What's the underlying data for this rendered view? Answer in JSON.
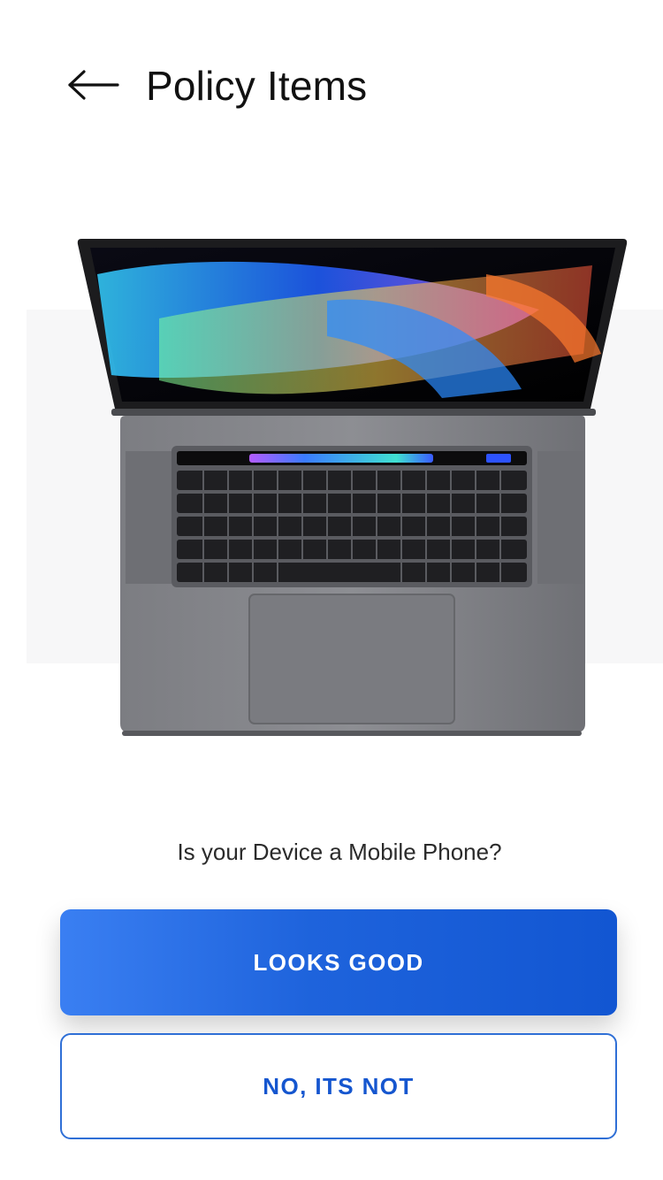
{
  "header": {
    "back_icon": "arrow-left-icon",
    "title": "Policy Items"
  },
  "device": {
    "image_kind": "laptop-photo"
  },
  "prompt": {
    "question": "Is your Device a Mobile Phone?"
  },
  "actions": {
    "confirm_label": "LOOKS GOOD",
    "deny_label": "NO, ITS NOT"
  },
  "colors": {
    "primary": "#1E63DC",
    "primary_light": "#3A7FF2",
    "outline": "#2F6FD6",
    "text_dark": "#111111"
  }
}
